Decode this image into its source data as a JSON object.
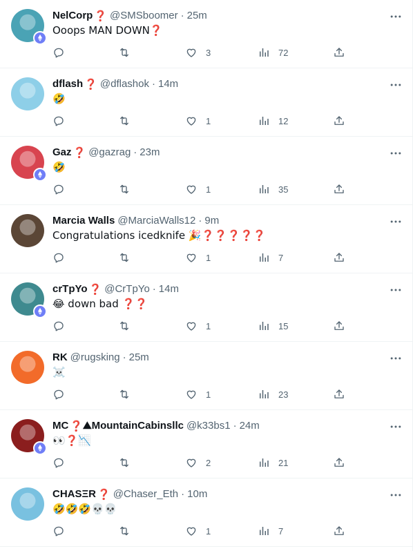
{
  "colors": {
    "text_primary": "#0f1419",
    "text_secondary": "#536471",
    "divider": "#eff3f4",
    "eth_badge": "#6f7ef7",
    "question_mark": "#dd2e44"
  },
  "icons": {
    "reply": "reply-icon",
    "retweet": "retweet-icon",
    "like": "like-icon",
    "views": "views-icon",
    "share": "share-icon",
    "more": "more-icon",
    "eth": "ethereum-badge-icon"
  },
  "tweets": [
    {
      "name": "NelCorp",
      "name_suffix": "❓",
      "handle": "@SMSboomer",
      "separator": "·",
      "time": "25m",
      "text": "Ooops MAN DOWN",
      "text_suffix": "❓",
      "likes": "3",
      "views": "72",
      "avatar_color": "#4aa3b5",
      "has_eth_badge": true
    },
    {
      "name": "dflash",
      "name_suffix": "❓",
      "handle": "@dflashok",
      "separator": "·",
      "time": "14m",
      "text": "🤣",
      "text_suffix": "",
      "likes": "1",
      "views": "12",
      "avatar_color": "#8ecfe8",
      "has_eth_badge": false
    },
    {
      "name": "Gaz",
      "name_suffix": "❓",
      "handle": "@gazrag",
      "separator": "·",
      "time": "23m",
      "text": "🤣",
      "text_suffix": "",
      "likes": "1",
      "views": "35",
      "avatar_color": "#d8444f",
      "has_eth_badge": true
    },
    {
      "name": "Marcia Walls",
      "name_suffix": "",
      "handle": "@MarciaWalls12",
      "separator": "·",
      "time": "9m",
      "text": "Congratulations icedknife 🎉",
      "text_suffix": "❓❓❓❓❓",
      "likes": "1",
      "views": "7",
      "avatar_color": "#5b4636",
      "has_eth_badge": false
    },
    {
      "name": "crTpYo",
      "name_suffix": "❓",
      "handle": "@CrTpYo",
      "separator": "·",
      "time": "14m",
      "text": "😂 down bad ",
      "text_suffix": "❓❓",
      "likes": "1",
      "views": "15",
      "avatar_color": "#3f8a8f",
      "has_eth_badge": true
    },
    {
      "name": "RK",
      "name_suffix": "",
      "handle": "@rugsking",
      "separator": "·",
      "time": "25m",
      "text": "☠️",
      "text_suffix": "",
      "likes": "1",
      "views": "23",
      "avatar_color": "#f26b2a",
      "has_eth_badge": false
    },
    {
      "name": "MC",
      "name_suffix": "❓",
      "name_extra": "⛰MountainCabinsllc",
      "handle": "@k33bs1",
      "separator": "·",
      "time": "24m",
      "text": "👀",
      "text_suffix": "❓",
      "text_after": "📉",
      "likes": "2",
      "views": "21",
      "avatar_color": "#8b1e1e",
      "has_eth_badge": true
    },
    {
      "name": "CHASΞR",
      "name_suffix": "❓",
      "handle": "@Chaser_Eth",
      "separator": "·",
      "time": "10m",
      "text": "🤣🤣🤣💀💀",
      "text_suffix": "",
      "likes": "1",
      "views": "7",
      "avatar_color": "#79c1e0",
      "has_eth_badge": false
    }
  ]
}
